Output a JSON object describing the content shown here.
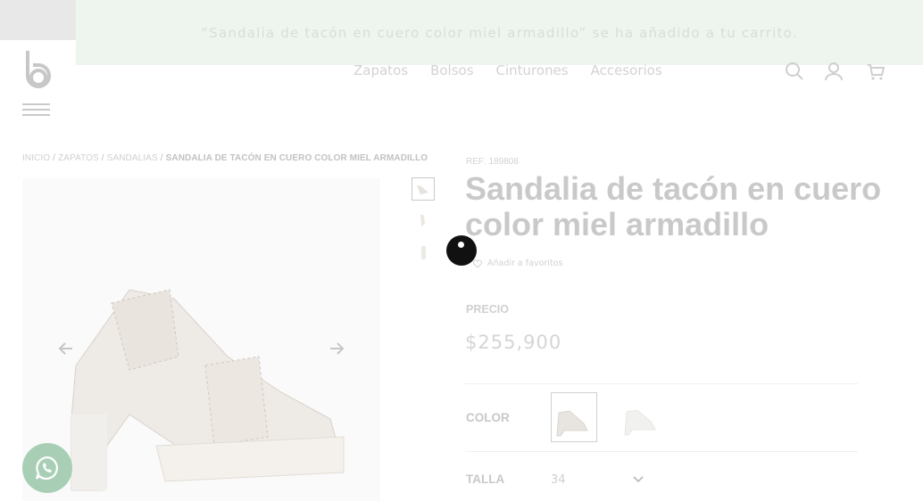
{
  "notice": {
    "text": "“Sandalia de tacón en cuero color miel armadillo” se ha añadido a tu carrito."
  },
  "header": {
    "nav": [
      {
        "label": "Zapatos"
      },
      {
        "label": "Bolsos"
      },
      {
        "label": "Cinturones"
      },
      {
        "label": "Accesorios"
      }
    ],
    "icons": [
      "search-icon",
      "user-icon",
      "cart-icon"
    ]
  },
  "breadcrumb": {
    "items": [
      "INICIO",
      "ZAPATOS",
      "SANDALIAS"
    ],
    "current": "SANDALIA DE TACÓN EN CUERO COLOR MIEL ARMADILLO",
    "separator": "/"
  },
  "product": {
    "ref": "REF: 189808",
    "title": "Sandalia de tacón en cuero color miel armadillo",
    "favorite_label": "Añadir a favoritos",
    "price_label": "PRECIO",
    "price": "$255,900",
    "color_label": "COLOR",
    "size_label": "TALLA",
    "size_value": "34"
  },
  "colors": {
    "notice_bg": "#eef5ee",
    "whatsapp": "#a8cfb5"
  }
}
